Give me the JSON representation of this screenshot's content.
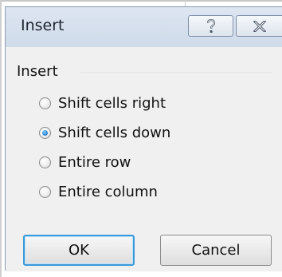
{
  "dialog": {
    "title": "Insert",
    "help_label": "?",
    "close_label": "X"
  },
  "group": {
    "label": "Insert"
  },
  "options": [
    {
      "label": "Shift cells right",
      "checked": false
    },
    {
      "label": "Shift cells down",
      "checked": true
    },
    {
      "label": "Entire row",
      "checked": false
    },
    {
      "label": "Entire column",
      "checked": false
    }
  ],
  "buttons": {
    "ok_label": "OK",
    "cancel_label": "Cancel"
  },
  "colors": {
    "accent": "#3c9ad8",
    "radio_selected": "#2f8bd8"
  }
}
